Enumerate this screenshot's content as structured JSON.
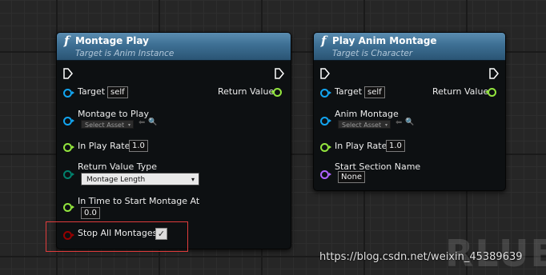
{
  "nodes": [
    {
      "title": "Montage Play",
      "subtitle": "Target is Anim Instance",
      "target_label": "Target",
      "target_value": "self",
      "return_label": "Return Value",
      "montage_label": "Montage to Play",
      "montage_asset": "Select Asset",
      "play_rate_label": "In Play Rate",
      "play_rate_value": "1.0",
      "return_type_label": "Return Value Type",
      "return_type_value": "Montage Length",
      "time_to_start_label": "In Time to Start Montage At",
      "time_to_start_value": "0.0",
      "stop_all_label": "Stop All Montages",
      "stop_all_checked": "✓"
    },
    {
      "title": "Play Anim Montage",
      "subtitle": "Target is Character",
      "target_label": "Target",
      "target_value": "self",
      "return_label": "Return Value",
      "montage_label": "Anim Montage",
      "montage_asset": "Select Asset",
      "play_rate_label": "In Play Rate",
      "play_rate_value": "1.0",
      "section_label": "Start Section Name",
      "section_value": "None"
    }
  ],
  "watermark": "https://blog.csdn.net/weixin_45389639",
  "logo_text": "RLUE",
  "icons": {
    "function": "f",
    "caret": "▾",
    "arrow": "⬅",
    "search": "🔍",
    "checkmark": "✓"
  },
  "colors": {
    "header": "#3d6f93",
    "pin_object": "#12a5f1",
    "pin_float": "#93e53e",
    "pin_enum": "#01816d",
    "pin_name": "#b063ff",
    "pin_bool": "#970000",
    "highlight": "#e03c3c"
  }
}
